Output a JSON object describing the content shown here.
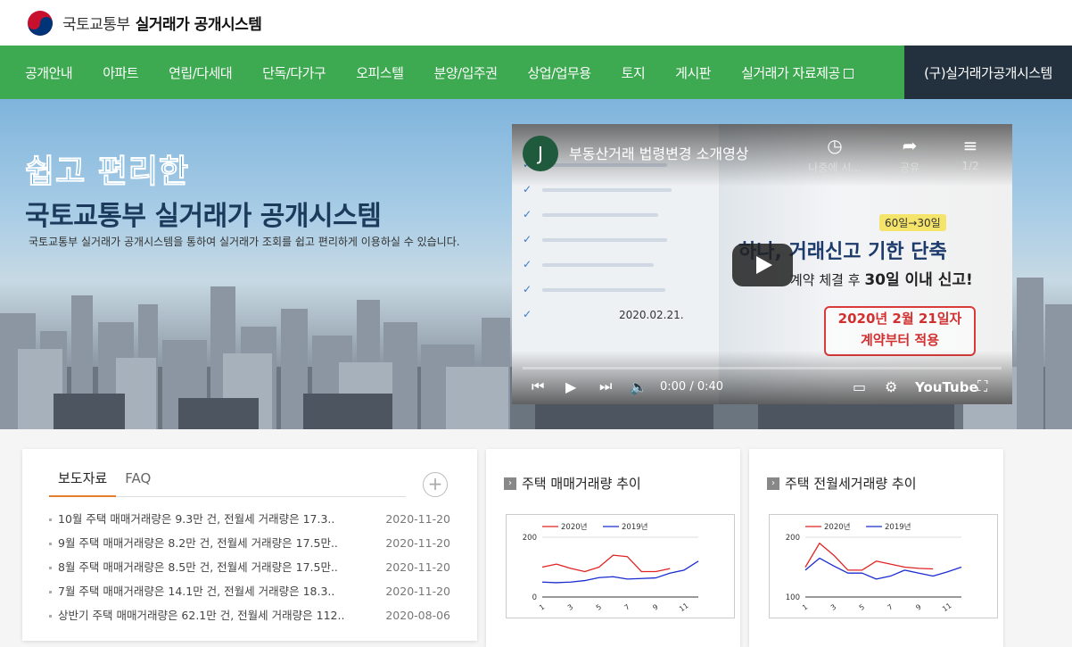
{
  "header": {
    "org": "국토교통부",
    "system": "실거래가 공개시스템"
  },
  "nav": {
    "items": [
      "공개안내",
      "아파트",
      "연립/다세대",
      "단독/다가구",
      "오피스텔",
      "분양/입주권",
      "상업/업무용",
      "토지",
      "게시판",
      "실거래가 자료제공"
    ],
    "old_system": "(구)실거래가공개시스템"
  },
  "hero": {
    "tagline": "쉽고 편리한",
    "title": "국토교통부 실거래가 공개시스템",
    "desc": "국토교통부 실거래가 공개시스템을 통하여 실거래가 조회를 쉽고 편리하게 이용하실 수 있습니다."
  },
  "video": {
    "channel_initial": "J",
    "title": "부동산거래 법령변경 소개영상",
    "watch_later": "나중에 시...",
    "share": "공유",
    "playlist": "1/2",
    "time": "0:00 / 0:40",
    "brand": "YouTube",
    "thumb": {
      "days": "60일→30일",
      "headline": "하나, 거래신고 기한 단축",
      "sub_prefix": "계약 체결 후",
      "sub_bold": "30일 이내 신고!",
      "stamp_line1": "2020년 2월 21일자",
      "stamp_line2": "계약부터 적용",
      "date": "2020.02.21."
    }
  },
  "news": {
    "tabs": [
      "보도자료",
      "FAQ"
    ],
    "more": "+",
    "items": [
      {
        "title": "10월 주택 매매거래량은 9.3만 건, 전월세 거래량은 17.3..",
        "date": "2020-11-20"
      },
      {
        "title": "9월 주택 매매거래량은 8.2만 건, 전월세 거래량은 17.5만..",
        "date": "2020-11-20"
      },
      {
        "title": "8월 주택 매매거래량은 8.5만 건, 전월세 거래량은 17.5만..",
        "date": "2020-11-20"
      },
      {
        "title": "7월 주택 매매거래량은 14.1만 건, 전월세 거래량은 18.3..",
        "date": "2020-11-20"
      },
      {
        "title": "상반기 주택 매매거래량은 62.1만 건, 전월세 거래량은 112..",
        "date": "2020-08-06"
      }
    ]
  },
  "panels": {
    "sale_title": "주택 매매거래량 추이",
    "rent_title": "주택 전월세거래량 추이"
  },
  "colors": {
    "nav": "#3da950",
    "old_nav": "#23303e",
    "series_2020": "#e02424",
    "series_2019": "#1a2ccf"
  },
  "chart_data": [
    {
      "type": "line",
      "title": "주택 매매거래량 추이",
      "x": [
        1,
        2,
        3,
        4,
        5,
        6,
        7,
        8,
        9,
        10,
        11,
        12
      ],
      "xticks": [
        "1",
        "3",
        "5",
        "7",
        "9",
        "11"
      ],
      "ylim": [
        0,
        200
      ],
      "yticks": [
        "0",
        "200"
      ],
      "series": [
        {
          "name": "2020년",
          "values": [
            100,
            110,
            96,
            85,
            100,
            140,
            135,
            85,
            85,
            95,
            null,
            null
          ]
        },
        {
          "name": "2019년",
          "values": [
            50,
            48,
            50,
            55,
            65,
            68,
            60,
            62,
            64,
            80,
            90,
            120
          ]
        }
      ]
    },
    {
      "type": "line",
      "title": "주택 전월세거래량 추이",
      "x": [
        1,
        2,
        3,
        4,
        5,
        6,
        7,
        8,
        9,
        10,
        11,
        12
      ],
      "xticks": [
        "1",
        "3",
        "5",
        "7",
        "9",
        "11"
      ],
      "ylim": [
        100,
        200
      ],
      "yticks": [
        "100",
        "200"
      ],
      "series": [
        {
          "name": "2020년",
          "values": [
            150,
            190,
            170,
            145,
            145,
            160,
            155,
            150,
            148,
            147,
            null,
            null
          ]
        },
        {
          "name": "2019년",
          "values": [
            145,
            165,
            152,
            140,
            140,
            130,
            135,
            145,
            140,
            135,
            142,
            150
          ]
        }
      ]
    }
  ]
}
